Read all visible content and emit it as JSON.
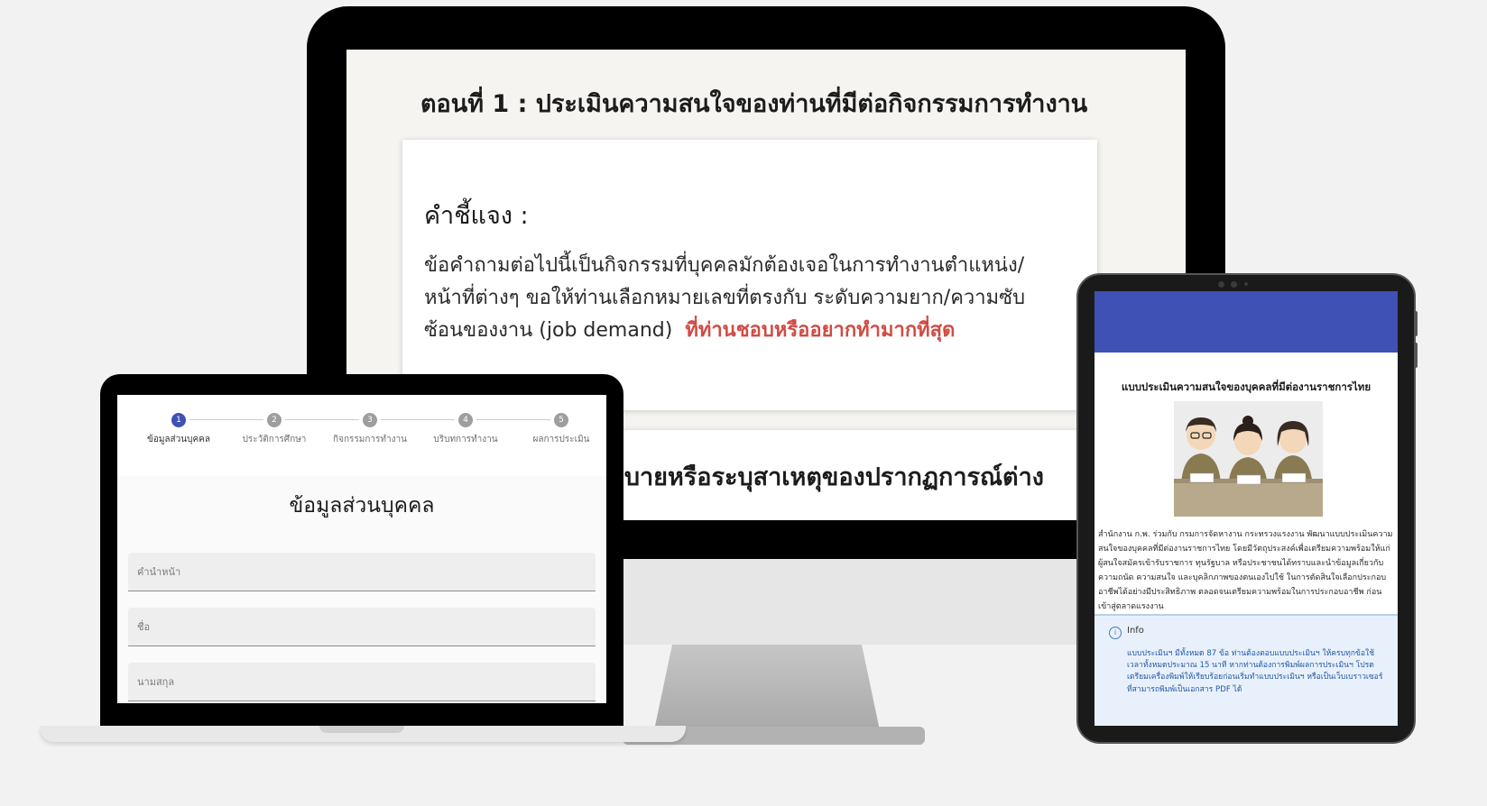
{
  "desktop": {
    "section_title": "ตอนที่ 1 : ประเมินความสนใจของท่านที่มีต่อกิจกรรมการทำงาน",
    "card_heading": "คำชี้แจง :",
    "card_body": "ข้อคำถามต่อไปนี้เป็นกิจกรรมที่บุคคลมักต้องเจอในการทำงานตำแหน่ง/หน้าที่ต่างๆ ขอให้ท่านเลือกหมายเลขที่ตรงกับ ระดับความยาก/ความซับซ้อนของงาน (job demand)",
    "card_highlight": "ที่ท่านชอบหรืออยากทำมากที่สุด",
    "card2_text": "งอธิบายหรือระบุสาเหตุของปรากฏการณ์ต่าง"
  },
  "laptop": {
    "steps": [
      {
        "num": "1",
        "label": "ข้อมูลส่วนบุคคล"
      },
      {
        "num": "2",
        "label": "ประวัติการศึกษา"
      },
      {
        "num": "3",
        "label": "กิจกรรมการทำงาน"
      },
      {
        "num": "4",
        "label": "บริบทการทำงาน"
      },
      {
        "num": "5",
        "label": "ผลการประเมิน"
      }
    ],
    "form_title": "ข้อมูลส่วนบุคคล",
    "fields": [
      {
        "placeholder": "คำนำหน้า"
      },
      {
        "placeholder": "ชื่อ"
      },
      {
        "placeholder": "นามสกุล"
      }
    ]
  },
  "tablet": {
    "title": "แบบประเมินความสนใจของบุคคลที่มีต่องานราชการไทย",
    "description": "สำนักงาน ก.พ. ร่วมกับ กรมการจัดหางาน กระทรวงแรงงาน พัฒนาแบบประเมินความสนใจของบุคคลที่มีต่องานราชการไทย โดยมีวัตถุประสงค์เพื่อเตรียมความพร้อมให้แก่ผู้สนใจสมัครเข้ารับราชการ ทุนรัฐบาล หรือประชาชนได้ทราบและนำข้อมูลเกี่ยวกับความถนัด ความสนใจ และบุคลิกภาพของตนเองไปใช้ ในการตัดสินใจเลือกประกอบอาชีพได้อย่างมีประสิทธิภาพ ตลอดจนเตรียมความพร้อมในการประกอบอาชีพ ก่อนเข้าสู่ตลาดแรงงาน",
    "info_label": "Info",
    "info_icon": "info-icon",
    "info_text": "แบบประเมินฯ มีทั้งหมด 87 ข้อ ท่านต้องตอบแบบประเมินฯ ให้ครบทุกข้อใช้เวลาทั้งหมดประมาณ 15 นาที หากท่านต้องการพิมพ์ผลการประเมินฯ โปรดเตรียมเครื่องพิมพ์ให้เรียบร้อยก่อนเริ่มทำแบบประเมินฯ หรือเป็นเว็บเบราวเซอร์ที่สามารถพิมพ์เป็นเอกสาร PDF ได้"
  },
  "colors": {
    "accent": "#3f51b5",
    "highlight": "#d14b43",
    "info_text": "#2456a6",
    "info_bg": "#e8f1fb"
  }
}
